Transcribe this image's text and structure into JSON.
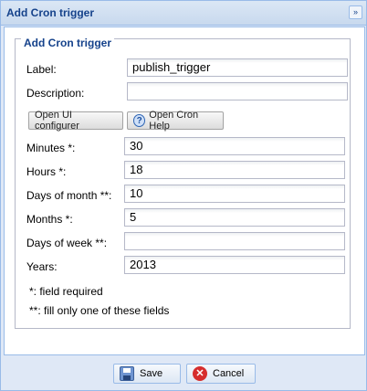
{
  "window": {
    "title": "Add Cron trigger",
    "collapse_symbol": "»"
  },
  "form": {
    "legend": "Add Cron trigger",
    "fields": {
      "label": {
        "label": "Label:",
        "value": "publish_trigger"
      },
      "description": {
        "label": "Description:",
        "value": ""
      },
      "minutes": {
        "label": "Minutes *:",
        "value": "30"
      },
      "hours": {
        "label": "Hours *:",
        "value": "18"
      },
      "days_of_month": {
        "label": "Days of month **:",
        "value": "10"
      },
      "months": {
        "label": "Months *:",
        "value": "5"
      },
      "days_of_week": {
        "label": "Days of week **:",
        "value": ""
      },
      "years": {
        "label": "Years:",
        "value": "2013"
      }
    },
    "buttons": {
      "open_ui_configurer": "Open UI configurer",
      "open_cron_help": "Open Cron Help"
    },
    "notes": {
      "required": "*: field required",
      "one_of": "**: fill only one of these fields"
    }
  },
  "footer": {
    "save_label": "Save",
    "cancel_label": "Cancel"
  },
  "icons": {
    "help": "help-icon",
    "save": "save-icon",
    "cancel": "cancel-icon"
  }
}
